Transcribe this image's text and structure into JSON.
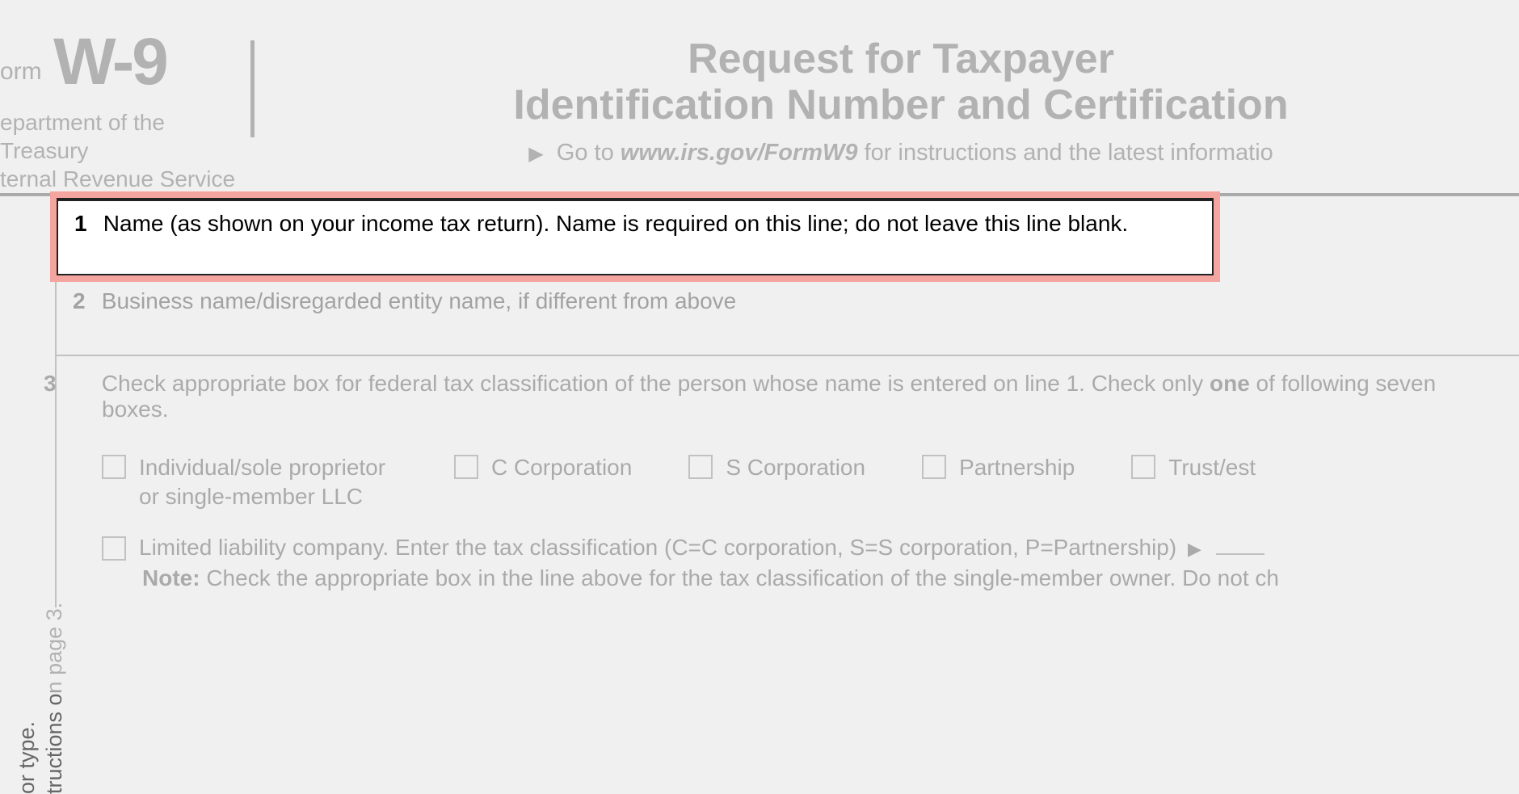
{
  "header": {
    "form_label": "orm",
    "form_code": "W-9",
    "dept_line1": "epartment of the Treasury",
    "dept_line2": "ternal Revenue Service",
    "title_line1": "Request for Taxpayer",
    "title_line2": "Identification Number and Certification",
    "goto_prefix": "Go to ",
    "goto_url": "www.irs.gov/FormW9",
    "goto_suffix": " for instructions and the latest informatio"
  },
  "side": {
    "text1": "or type.",
    "text2": "tructions on page 3."
  },
  "fields": {
    "line1": {
      "num": "1",
      "text": "Name (as shown on your income tax return). Name is required on this line; do not leave this line blank."
    },
    "line2": {
      "num": "2",
      "text": "Business name/disregarded entity name, if different from above"
    },
    "line3": {
      "num": "3",
      "text_a": "Check appropriate box for federal tax classification of the person whose name is entered on line 1. Check only ",
      "text_one": "one",
      "text_b": " of following seven boxes."
    }
  },
  "checkboxes": {
    "individual": "Individual/sole proprietor or single-member LLC",
    "c_corp": "C Corporation",
    "s_corp": "S Corporation",
    "partnership": "Partnership",
    "trust": "Trust/est"
  },
  "llc": {
    "text": "Limited liability company. Enter the tax classification (C=C corporation, S=S corporation, P=Partnership)"
  },
  "note": {
    "label": "Note:",
    "text": " Check the appropriate box in the line above for the tax classification of the single-member owner.  Do not ch"
  }
}
